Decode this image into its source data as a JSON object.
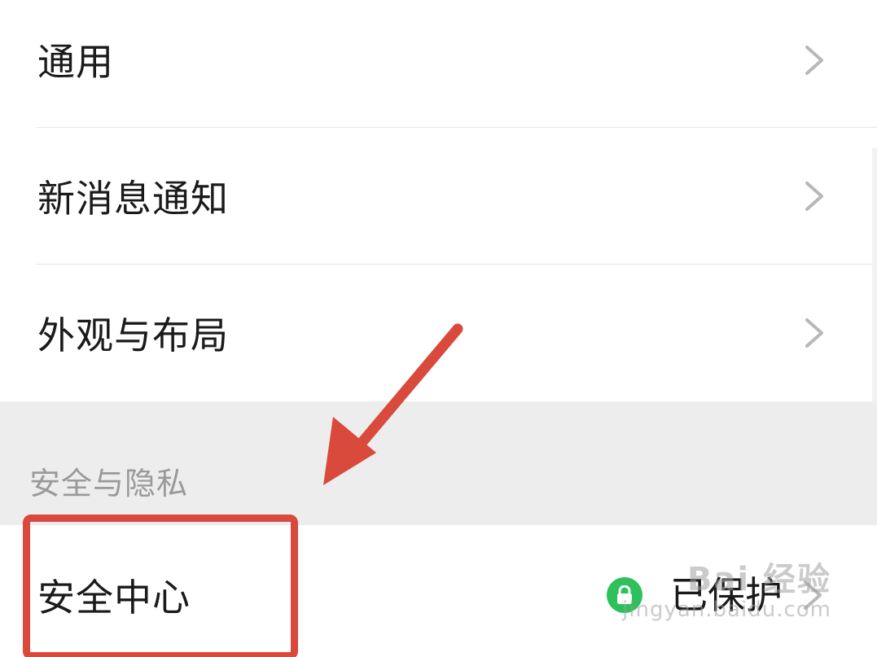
{
  "settings": {
    "items": [
      {
        "label": "通用"
      },
      {
        "label": "新消息通知"
      },
      {
        "label": "外观与布局"
      }
    ],
    "section_title": "安全与隐私",
    "security_center": {
      "label": "安全中心",
      "status": "已保护"
    }
  },
  "icons": {
    "chevron": "chevron-right-icon",
    "lock": "lock-icon"
  },
  "annotation": {
    "arrow_color": "#d9493c",
    "box_color": "#d9493c"
  },
  "watermark": {
    "brand": "Bai 经验",
    "url": "jingyan.baidu.com"
  },
  "colors": {
    "status_green": "#2ec05a",
    "section_bg": "#ededed"
  }
}
